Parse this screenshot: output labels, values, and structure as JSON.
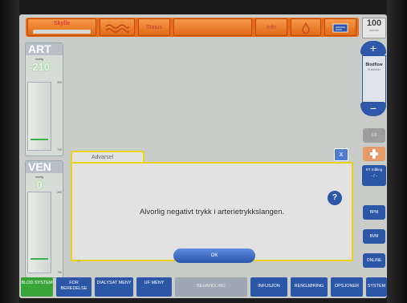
{
  "topbar": {
    "skylle_label": "Skylle",
    "status_label": "Status",
    "info_label": "Info"
  },
  "volume": {
    "value": "100",
    "unit": "ml/min"
  },
  "bloodflow": {
    "label": "Blodflow",
    "sub": "0 ml/min"
  },
  "art": {
    "title": "ART",
    "sub": "mmHg",
    "value": "-210",
    "tick_top": "300",
    "tick_bottom": "700"
  },
  "ven": {
    "title": "VEN",
    "sub": "mmHg",
    "value": "0",
    "tick_top": "390",
    "tick_bottom": "700"
  },
  "right": {
    "grey_label": "1/2",
    "bt_label": "BT måling",
    "bt_value": "- / -",
    "bpm": "BPM",
    "bvm": "BVM",
    "online": "ONLINE"
  },
  "dialog": {
    "tab": "Advarsel",
    "message": "Alvorlig negativt trykk i arterietrykkslangen.",
    "ok": "OK",
    "close": "x",
    "help": "?",
    "foot": "10"
  },
  "bottom": {
    "blod": "BLOD SYSTEM",
    "forberedelse": "FOR BEREDELSE",
    "dialysat": "DIALYSAT MENY",
    "uf": "UF MENY",
    "behandling": "BEHANDLING",
    "infusjon": "INFUSJON",
    "rengjoring": "RENGJØRING",
    "opsjoner": "OPSJONER",
    "system": "SYSTEM"
  },
  "colors": {
    "accent": "#e76d1a",
    "blue": "#2c57a6",
    "warning": "#e8d21b",
    "green": "#3aa43a"
  }
}
